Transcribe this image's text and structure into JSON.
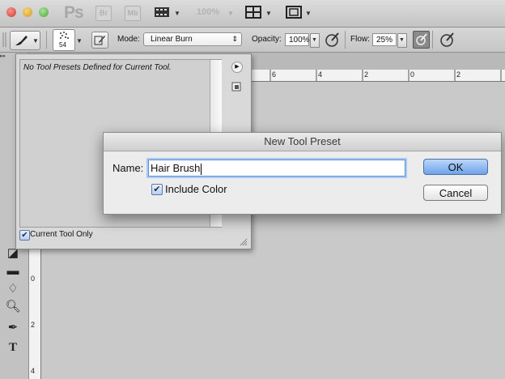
{
  "appbar": {
    "logo": "Ps",
    "bridge_label": "Br",
    "minibridge_label": "Mb",
    "zoom": "100%"
  },
  "options": {
    "brush_size": "54",
    "mode_label": "Mode:",
    "mode_value": "Linear Burn",
    "opacity_label": "Opacity:",
    "opacity_value": "100%",
    "flow_label": "Flow:",
    "flow_value": "25%"
  },
  "rulers": {
    "top": [
      "6",
      "4",
      "2",
      "0",
      "2"
    ],
    "left": [
      "0",
      "2",
      "4"
    ]
  },
  "presets_panel": {
    "empty_message": "No Tool Presets Defined for Current Tool.",
    "current_tool_only_label": "Current Tool Only",
    "current_tool_only_checked": true
  },
  "dialog": {
    "title": "New Tool Preset",
    "name_label": "Name:",
    "name_value": "Hair Brush",
    "include_color_label": "Include Color",
    "include_color_checked": true,
    "ok_label": "OK",
    "cancel_label": "Cancel"
  },
  "colors": {
    "ok_button": "#6fa3ea",
    "focus_ring": "#a9c8f2",
    "close_light": "#e0443e",
    "minimize_light": "#d9a12a",
    "zoom_light": "#58b544"
  }
}
